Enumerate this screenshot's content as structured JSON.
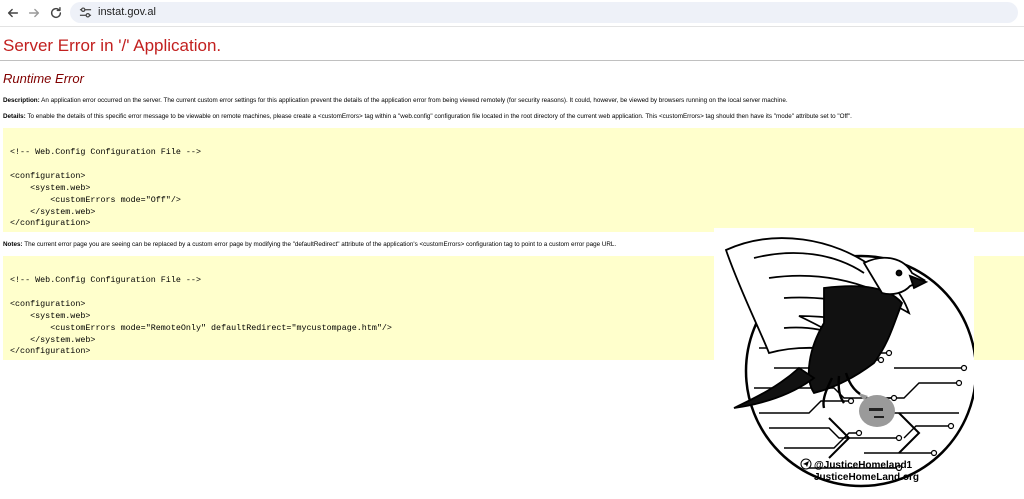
{
  "browser": {
    "url": "instat.gov.al",
    "icons": [
      "back-arrow-icon",
      "forward-arrow-icon",
      "reload-icon",
      "site-settings-icon"
    ]
  },
  "page": {
    "title": "Server Error in '/' Application.",
    "subtitle": "Runtime Error",
    "description_label": "Description:",
    "description_text": " An application error occurred on the server. The current custom error settings for this application prevent the details of the application error from being viewed remotely (for security reasons). It could, however, be viewed by browsers running on the local server machine.",
    "details_label": "Details:",
    "details_text": " To enable the details of this specific error message to be viewable on remote machines, please create a <customErrors> tag within a \"web.config\" configuration file located in the root directory of the current web application. This <customErrors> tag should then have its \"mode\" attribute set to \"Off\".",
    "code_block_1": "<!-- Web.Config Configuration File -->\n\n<configuration>\n    <system.web>\n        <customErrors mode=\"Off\"/>\n    </system.web>\n</configuration>",
    "notes_label": "Notes:",
    "notes_text": " The current error page you are seeing can be replaced by a custom error page by modifying the \"defaultRedirect\" attribute of the application's <customErrors> configuration tag to point to a custom error page URL.",
    "code_block_2": "<!-- Web.Config Configuration File -->\n\n<configuration>\n    <system.web>\n        <customErrors mode=\"RemoteOnly\" defaultRedirect=\"mycustompage.htm\"/>\n    </system.web>\n</configuration>"
  },
  "watermark": {
    "handle": "@JusticeHomeland1",
    "site": "JusticeHomeLand.org"
  },
  "colors": {
    "title_red": "#c2201f",
    "subtitle_maroon": "#800000",
    "code_bg": "#ffffcc"
  }
}
